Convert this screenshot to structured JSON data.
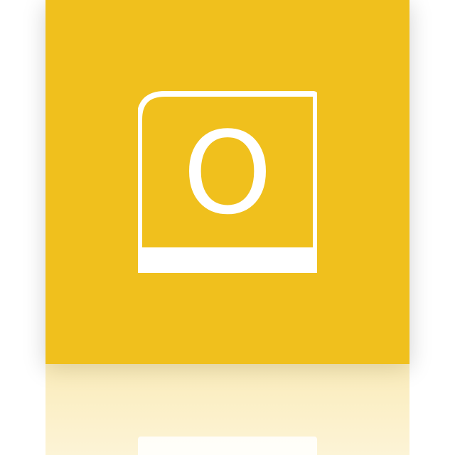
{
  "tile": {
    "background_color": "#F0C01D",
    "foreground_color": "#FFFFFF"
  },
  "logo": {
    "icon_name": "outlook-app-icon",
    "letter": "O"
  }
}
